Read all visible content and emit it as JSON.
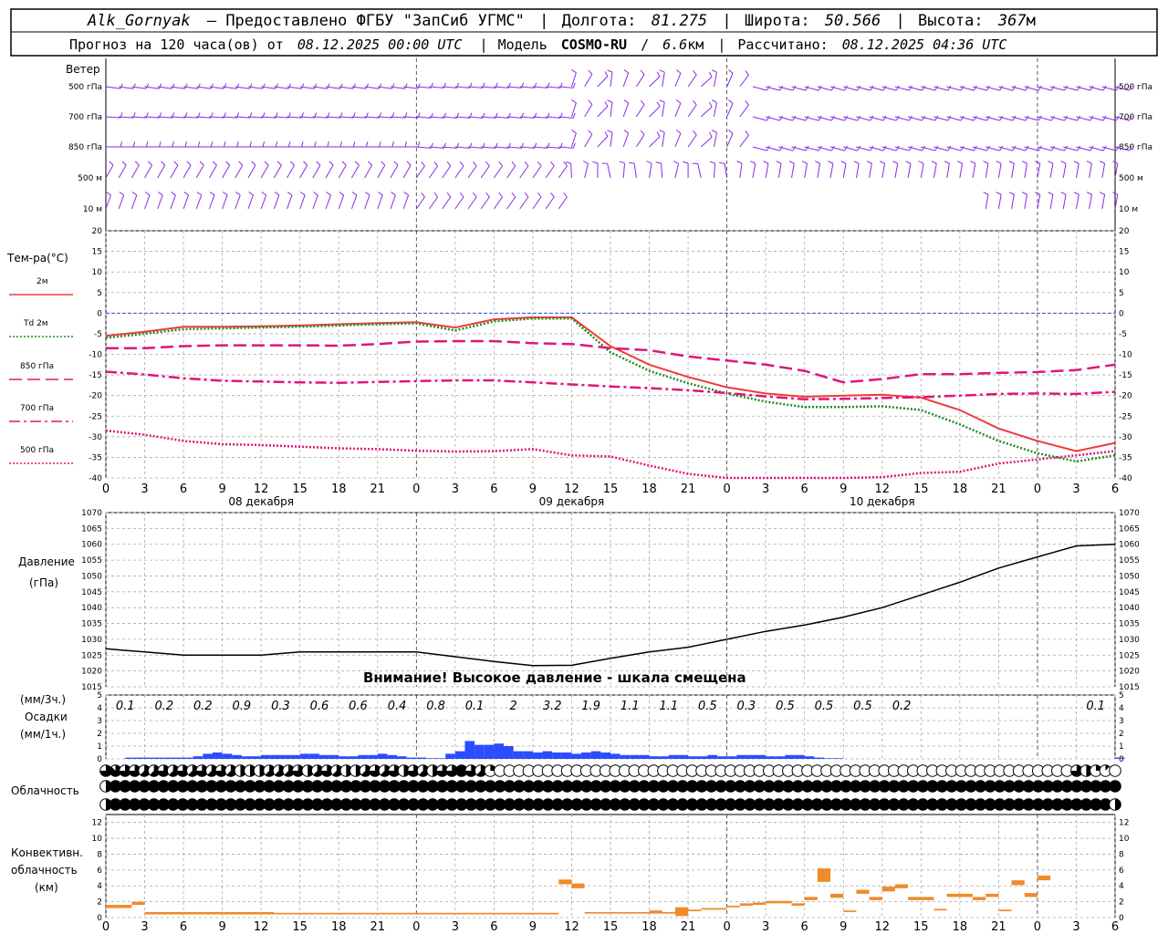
{
  "header": {
    "station": "Alk_Gornyak",
    "provider": "— Предоставлено ФГБУ \"ЗапСиб УГМС\"",
    "lon_label": "Долгота:",
    "lon_value": "81.275",
    "lat_label": "Широта:",
    "lat_value": "50.566",
    "alt_label": "Высота:",
    "alt_value": "367",
    "alt_unit": "м",
    "forecast_prefix": "Прогноз на 120 часа(ов) от",
    "forecast_start": "08.12.2025 00:00 UTC",
    "model_label": "Модель",
    "model_name": "COSMO-RU",
    "model_res": "6.6",
    "model_res_unit": "км",
    "calc_label": "Рассчитано:",
    "calc_time": "08.12.2025 04:36 UTC"
  },
  "wind_panel": {
    "title": "Ветер",
    "levels": [
      "500 гПа",
      "700 гПа",
      "850 гПа",
      "500 м",
      "10 м"
    ]
  },
  "x_axis": {
    "hours": [
      "0",
      "3",
      "6",
      "9",
      "12",
      "15",
      "18",
      "21",
      "0",
      "3",
      "6",
      "9",
      "12",
      "15",
      "18",
      "21",
      "0",
      "3",
      "6",
      "9",
      "12",
      "15",
      "18",
      "21",
      "0",
      "3",
      "6"
    ],
    "dates": [
      "08 декабря",
      "09 декабря",
      "10 декабря"
    ]
  },
  "chart_data": [
    {
      "type": "line",
      "panel": "temperature",
      "ylabel": "Тем-ра(°C)",
      "ylim": [
        -40,
        20
      ],
      "yticks": [
        20,
        15,
        10,
        5,
        0,
        -5,
        -10,
        -15,
        -20,
        -25,
        -30,
        -35,
        -40
      ],
      "x_hours": [
        0,
        3,
        6,
        9,
        12,
        15,
        18,
        21,
        24,
        27,
        30,
        33,
        36,
        39,
        42,
        45,
        48,
        51,
        54,
        57,
        60,
        63,
        66,
        69,
        72,
        75,
        78
      ],
      "legend": [
        "2м",
        "Td 2м",
        "850 гПа",
        "700 гПа",
        "500 гПа"
      ],
      "series": [
        {
          "name": "2м",
          "color": "#ee3b3b",
          "style": "solid",
          "values": [
            -5.5,
            -4.5,
            -3.3,
            -3.3,
            -3.2,
            -3.0,
            -2.7,
            -2.4,
            -2.2,
            -3.5,
            -1.5,
            -1.0,
            -1.0,
            -8.0,
            -12.5,
            -15.5,
            -18.0,
            -19.5,
            -20.3,
            -20.0,
            -19.8,
            -20.5,
            -23.5,
            -28.0,
            -31.0,
            -33.5,
            -31.5
          ]
        },
        {
          "name": "Td 2м",
          "color": "#228b22",
          "style": "dotted",
          "values": [
            -6.0,
            -5.0,
            -3.9,
            -3.7,
            -3.5,
            -3.3,
            -3.0,
            -2.7,
            -2.5,
            -4.2,
            -2.0,
            -1.3,
            -1.3,
            -9.5,
            -14.0,
            -17.0,
            -19.5,
            -21.5,
            -22.8,
            -22.8,
            -22.6,
            -23.5,
            -27.0,
            -31.0,
            -34.0,
            -36.0,
            -34.5
          ]
        },
        {
          "name": "850 гПа",
          "color": "#e0147a",
          "style": "dashed",
          "values": [
            -8.5,
            -8.5,
            -8.0,
            -7.8,
            -7.8,
            -7.8,
            -7.9,
            -7.5,
            -6.9,
            -6.8,
            -6.8,
            -7.3,
            -7.5,
            -8.5,
            -9.0,
            -10.5,
            -11.5,
            -12.5,
            -14.0,
            -16.8,
            -16.0,
            -14.8,
            -14.8,
            -14.5,
            -14.3,
            -13.8,
            -12.5
          ]
        },
        {
          "name": "700 гПа",
          "color": "#e0147a",
          "style": "dashdot",
          "values": [
            -14.2,
            -14.9,
            -15.8,
            -16.4,
            -16.6,
            -16.8,
            -16.9,
            -16.7,
            -16.5,
            -16.3,
            -16.3,
            -16.8,
            -17.3,
            -17.8,
            -18.2,
            -18.7,
            -19.4,
            -20.2,
            -20.9,
            -20.8,
            -20.6,
            -20.4,
            -20.0,
            -19.6,
            -19.5,
            -19.6,
            -19.1
          ]
        },
        {
          "name": "500 гПа",
          "color": "#e0147a",
          "style": "dotted",
          "values": [
            -28.5,
            -29.5,
            -31.0,
            -31.8,
            -32.0,
            -32.4,
            -32.8,
            -33.0,
            -33.4,
            -33.6,
            -33.5,
            -33.0,
            -34.5,
            -34.8,
            -37.0,
            -39.0,
            -40.5,
            -41.5,
            -41.5,
            -40.0,
            -39.8,
            -38.8,
            -38.5,
            -36.5,
            -35.5,
            -34.5,
            -33.5
          ]
        }
      ]
    },
    {
      "type": "line",
      "panel": "pressure",
      "ylabel": "Давление (гПа)",
      "ylim": [
        1015,
        1070
      ],
      "yticks": [
        1070,
        1065,
        1060,
        1055,
        1050,
        1045,
        1040,
        1035,
        1030,
        1025,
        1020,
        1015
      ],
      "x_hours": [
        0,
        3,
        6,
        9,
        12,
        15,
        18,
        21,
        24,
        27,
        30,
        33,
        36,
        39,
        42,
        45,
        48,
        51,
        54,
        57,
        60,
        63,
        66,
        69,
        72,
        75,
        78
      ],
      "series": [
        {
          "name": "",
          "color": "#000000",
          "style": "solid",
          "values": [
            1027,
            1026,
            1025,
            1025,
            1025,
            1026,
            1026,
            1026,
            1026,
            1024.5,
            1023,
            1021.7,
            1021.8,
            1024,
            1026,
            1027.5,
            1030,
            1032.5,
            1034.5,
            1037,
            1040,
            1044,
            1048,
            1052.5,
            1056,
            1059.5,
            1060
          ]
        }
      ],
      "annotation": "Внимание! Высокое давление - шкала смещена"
    },
    {
      "type": "bar",
      "panel": "precipitation",
      "ylabel": "(мм/3ч.) Осадки (мм/1ч.)",
      "ylim": [
        0,
        5
      ],
      "yticks": [
        5,
        4,
        3,
        2,
        1,
        0
      ],
      "color": "#2b4cff",
      "labels_3h": [
        "0.1",
        "0.2",
        "0.2",
        "0.9",
        "0.3",
        "0.6",
        "0.6",
        "0.4",
        "0.8",
        "0.1",
        "2",
        "3.2",
        "1.9",
        "1.1",
        "1.1",
        "0.5",
        "0.3",
        "0.5",
        "0.5",
        "0.5",
        "0.2",
        "",
        "",
        "",
        "",
        "0.1"
      ],
      "hourly_values": [
        0,
        0,
        0.1,
        0.1,
        0.1,
        0.1,
        0.1,
        0.1,
        0.1,
        0.2,
        0.4,
        0.5,
        0.4,
        0.3,
        0.2,
        0.2,
        0.3,
        0.3,
        0.3,
        0.3,
        0.4,
        0.4,
        0.3,
        0.3,
        0.2,
        0.2,
        0.3,
        0.3,
        0.4,
        0.3,
        0.2,
        0.1,
        0.1,
        0.05,
        0.05,
        0.4,
        0.6,
        1.4,
        1.1,
        1.1,
        1.2,
        1.0,
        0.6,
        0.6,
        0.5,
        0.6,
        0.5,
        0.5,
        0.4,
        0.5,
        0.6,
        0.5,
        0.4,
        0.3,
        0.3,
        0.3,
        0.2,
        0.2,
        0.3,
        0.3,
        0.2,
        0.2,
        0.3,
        0.2,
        0.2,
        0.3,
        0.3,
        0.3,
        0.2,
        0.2,
        0.3,
        0.3,
        0.2,
        0.1,
        0.05,
        0.05,
        0,
        0,
        0,
        0,
        0,
        0,
        0,
        0,
        0,
        0,
        0,
        0,
        0,
        0,
        0,
        0,
        0,
        0,
        0,
        0,
        0,
        0,
        0,
        0,
        0,
        0,
        0,
        0,
        0.1,
        0
      ]
    },
    {
      "type": "heatmap",
      "panel": "cloudiness",
      "ylabel": "Облачность",
      "rows": [
        "high",
        "middle",
        "low"
      ],
      "cover_eighths": {
        "high": [
          6,
          7,
          6,
          6,
          5,
          5,
          6,
          5,
          6,
          5,
          6,
          5,
          6,
          5,
          4,
          4,
          4,
          5,
          5,
          5,
          6,
          4,
          5,
          6,
          5,
          4,
          4,
          5,
          6,
          5,
          6,
          4,
          6,
          5,
          4,
          6,
          6,
          8,
          6,
          5,
          2,
          0,
          0,
          0,
          0,
          0,
          0,
          0,
          0,
          0,
          0,
          0,
          0,
          0,
          0,
          0,
          0,
          0,
          0,
          0,
          0,
          0,
          0,
          0,
          0,
          0,
          0,
          0,
          0,
          0,
          0,
          0,
          0,
          0,
          0,
          0,
          0,
          0,
          0,
          0,
          0,
          0,
          0,
          0,
          0,
          0,
          0,
          0,
          0,
          0,
          0,
          0,
          0,
          0,
          0,
          0,
          0,
          0,
          0,
          0,
          0,
          6,
          4,
          2,
          1,
          0
        ],
        "middle": [
          4,
          8,
          8,
          8,
          8,
          8,
          8,
          8,
          8,
          8,
          8,
          8,
          8,
          8,
          8,
          8,
          8,
          8,
          8,
          8,
          8,
          8,
          8,
          8,
          8,
          8,
          8,
          8,
          8,
          8,
          8,
          8,
          8,
          8,
          8,
          8,
          8,
          8,
          8,
          8,
          8,
          8,
          8,
          8,
          8,
          8,
          8,
          8,
          8,
          8,
          8,
          8,
          8,
          8,
          8,
          8,
          8,
          8,
          8,
          8,
          8,
          8,
          8,
          8,
          8,
          8,
          8,
          8,
          8,
          8,
          8,
          8,
          8,
          8,
          8,
          8,
          8,
          8,
          8,
          8,
          8,
          8,
          8,
          8,
          8,
          8,
          8,
          8,
          8,
          8,
          8,
          8,
          8,
          8,
          8,
          8,
          8,
          8,
          8,
          8,
          8,
          8,
          8,
          8,
          8,
          8
        ],
        "low": [
          4,
          8,
          8,
          8,
          8,
          8,
          8,
          8,
          8,
          8,
          8,
          8,
          8,
          8,
          8,
          8,
          8,
          8,
          8,
          8,
          8,
          8,
          8,
          8,
          8,
          8,
          8,
          8,
          8,
          8,
          8,
          8,
          8,
          8,
          8,
          8,
          8,
          8,
          8,
          8,
          8,
          8,
          8,
          8,
          8,
          8,
          8,
          8,
          8,
          8,
          8,
          8,
          8,
          8,
          8,
          8,
          8,
          8,
          8,
          8,
          8,
          8,
          8,
          8,
          8,
          8,
          8,
          8,
          8,
          8,
          8,
          8,
          8,
          8,
          8,
          8,
          8,
          8,
          8,
          8,
          8,
          8,
          8,
          8,
          8,
          8,
          8,
          8,
          8,
          8,
          8,
          8,
          8,
          8,
          8,
          8,
          8,
          8,
          8,
          8,
          8,
          8,
          8,
          8,
          8,
          4
        ]
      }
    },
    {
      "type": "bar",
      "panel": "convective",
      "ylabel": "Конвективн. облачность (км)",
      "ylim": [
        0,
        13
      ],
      "yticks": [
        12,
        10,
        8,
        6,
        4,
        2,
        0
      ],
      "color": "#f08a2a",
      "segments": [
        {
          "h": 0,
          "bottom": 1.2,
          "top": 1.6
        },
        {
          "h": 1,
          "bottom": 1.2,
          "top": 1.6
        },
        {
          "h": 2,
          "bottom": 1.6,
          "top": 2.0
        },
        {
          "h": 3,
          "bottom": 0.4,
          "top": 0.7
        },
        {
          "h": 4,
          "bottom": 0.4,
          "top": 0.7
        },
        {
          "h": 5,
          "bottom": 0.4,
          "top": 0.7
        },
        {
          "h": 6,
          "bottom": 0.4,
          "top": 0.7
        },
        {
          "h": 7,
          "bottom": 0.4,
          "top": 0.7
        },
        {
          "h": 8,
          "bottom": 0.4,
          "top": 0.7
        },
        {
          "h": 9,
          "bottom": 0.4,
          "top": 0.7
        },
        {
          "h": 10,
          "bottom": 0.4,
          "top": 0.7
        },
        {
          "h": 11,
          "bottom": 0.4,
          "top": 0.7
        },
        {
          "h": 12,
          "bottom": 0.4,
          "top": 0.7
        },
        {
          "h": 13,
          "bottom": 0.4,
          "top": 0.6
        },
        {
          "h": 14,
          "bottom": 0.4,
          "top": 0.6
        },
        {
          "h": 15,
          "bottom": 0.4,
          "top": 0.6
        },
        {
          "h": 16,
          "bottom": 0.4,
          "top": 0.6
        },
        {
          "h": 17,
          "bottom": 0.4,
          "top": 0.6
        },
        {
          "h": 18,
          "bottom": 0.4,
          "top": 0.6
        },
        {
          "h": 19,
          "bottom": 0.4,
          "top": 0.6
        },
        {
          "h": 20,
          "bottom": 0.4,
          "top": 0.6
        },
        {
          "h": 21,
          "bottom": 0.4,
          "top": 0.6
        },
        {
          "h": 22,
          "bottom": 0.4,
          "top": 0.6
        },
        {
          "h": 23,
          "bottom": 0.4,
          "top": 0.6
        },
        {
          "h": 24,
          "bottom": 0.4,
          "top": 0.6
        },
        {
          "h": 25,
          "bottom": 0.4,
          "top": 0.6
        },
        {
          "h": 26,
          "bottom": 0.4,
          "top": 0.6
        },
        {
          "h": 27,
          "bottom": 0.4,
          "top": 0.6
        },
        {
          "h": 28,
          "bottom": 0.4,
          "top": 0.6
        },
        {
          "h": 29,
          "bottom": 0.4,
          "top": 0.6
        },
        {
          "h": 30,
          "bottom": 0.4,
          "top": 0.6
        },
        {
          "h": 31,
          "bottom": 0.4,
          "top": 0.6
        },
        {
          "h": 32,
          "bottom": 0.4,
          "top": 0.6
        },
        {
          "h": 33,
          "bottom": 0.4,
          "top": 0.6
        },
        {
          "h": 34,
          "bottom": 0.4,
          "top": 0.6
        },
        {
          "h": 35,
          "bottom": 4.2,
          "top": 4.8
        },
        {
          "h": 36,
          "bottom": 3.7,
          "top": 4.3
        },
        {
          "h": 37,
          "bottom": 0.5,
          "top": 0.7
        },
        {
          "h": 38,
          "bottom": 0.5,
          "top": 0.7
        },
        {
          "h": 39,
          "bottom": 0.5,
          "top": 0.7
        },
        {
          "h": 40,
          "bottom": 0.5,
          "top": 0.7
        },
        {
          "h": 41,
          "bottom": 0.5,
          "top": 0.7
        },
        {
          "h": 42,
          "bottom": 0.5,
          "top": 0.9
        },
        {
          "h": 43,
          "bottom": 0.5,
          "top": 0.7
        },
        {
          "h": 44,
          "bottom": 0.2,
          "top": 1.3
        },
        {
          "h": 45,
          "bottom": 0.8,
          "top": 1.0
        },
        {
          "h": 46,
          "bottom": 1.0,
          "top": 1.2
        },
        {
          "h": 47,
          "bottom": 1.0,
          "top": 1.2
        },
        {
          "h": 48,
          "bottom": 1.3,
          "top": 1.5
        },
        {
          "h": 49,
          "bottom": 1.5,
          "top": 1.8
        },
        {
          "h": 50,
          "bottom": 1.6,
          "top": 1.9
        },
        {
          "h": 51,
          "bottom": 1.8,
          "top": 2.1
        },
        {
          "h": 52,
          "bottom": 1.8,
          "top": 2.1
        },
        {
          "h": 53,
          "bottom": 1.5,
          "top": 1.8
        },
        {
          "h": 54,
          "bottom": 2.2,
          "top": 2.6
        },
        {
          "h": 55,
          "bottom": 4.5,
          "top": 6.2
        },
        {
          "h": 56,
          "bottom": 2.5,
          "top": 3.0
        },
        {
          "h": 57,
          "bottom": 0.7,
          "top": 0.9
        },
        {
          "h": 58,
          "bottom": 3.0,
          "top": 3.5
        },
        {
          "h": 59,
          "bottom": 2.2,
          "top": 2.6
        },
        {
          "h": 60,
          "bottom": 3.3,
          "top": 3.9
        },
        {
          "h": 61,
          "bottom": 3.7,
          "top": 4.2
        },
        {
          "h": 62,
          "bottom": 2.2,
          "top": 2.6
        },
        {
          "h": 63,
          "bottom": 2.2,
          "top": 2.6
        },
        {
          "h": 64,
          "bottom": 0.9,
          "top": 1.1
        },
        {
          "h": 65,
          "bottom": 2.6,
          "top": 3.0
        },
        {
          "h": 66,
          "bottom": 2.6,
          "top": 3.0
        },
        {
          "h": 67,
          "bottom": 2.2,
          "top": 2.6
        },
        {
          "h": 68,
          "bottom": 2.6,
          "top": 3.0
        },
        {
          "h": 69,
          "bottom": 0.8,
          "top": 1.0
        },
        {
          "h": 70,
          "bottom": 4.1,
          "top": 4.7
        },
        {
          "h": 71,
          "bottom": 2.6,
          "top": 3.1
        },
        {
          "h": 72,
          "bottom": 4.7,
          "top": 5.3
        }
      ]
    }
  ]
}
